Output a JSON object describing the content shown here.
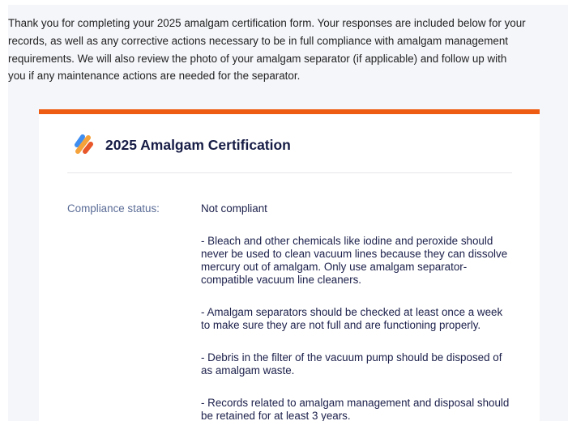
{
  "intro": {
    "lines": [
      "Thank you for completing your 2025 amalgam certification form. Your responses are included below for your",
      "records, as well as any corrective actions necessary to be in full compliance with amalgam management",
      "requirements. We will also review the photo of your amalgam separator (if applicable) and follow up with",
      "you if any maintenance actions are needed for the separator."
    ]
  },
  "card": {
    "title": "2025 Amalgam Certification",
    "logo_icon": "brand-stripes-icon",
    "accent_color": "#ee5b12",
    "compliance_label": "Compliance status:",
    "compliance_value": "Not compliant",
    "corrective_actions": [
      {
        "lines": [
          "- Bleach and other chemicals like iodine and peroxide should",
          "never be used to clean vacuum lines because they can dissolve",
          "mercury out of amalgam. Only use amalgam separator-",
          "compatible vacuum line cleaners."
        ]
      },
      {
        "lines": [
          "- Amalgam separators should be checked at least once a week",
          "to make sure they are not full and are functioning properly."
        ]
      },
      {
        "lines": [
          "- Debris in the filter of the vacuum pump should be disposed of",
          "as amalgam waste."
        ]
      },
      {
        "lines": [
          "- Records related to amalgam management and disposal should",
          "be retained for at least 3 years."
        ]
      }
    ]
  }
}
